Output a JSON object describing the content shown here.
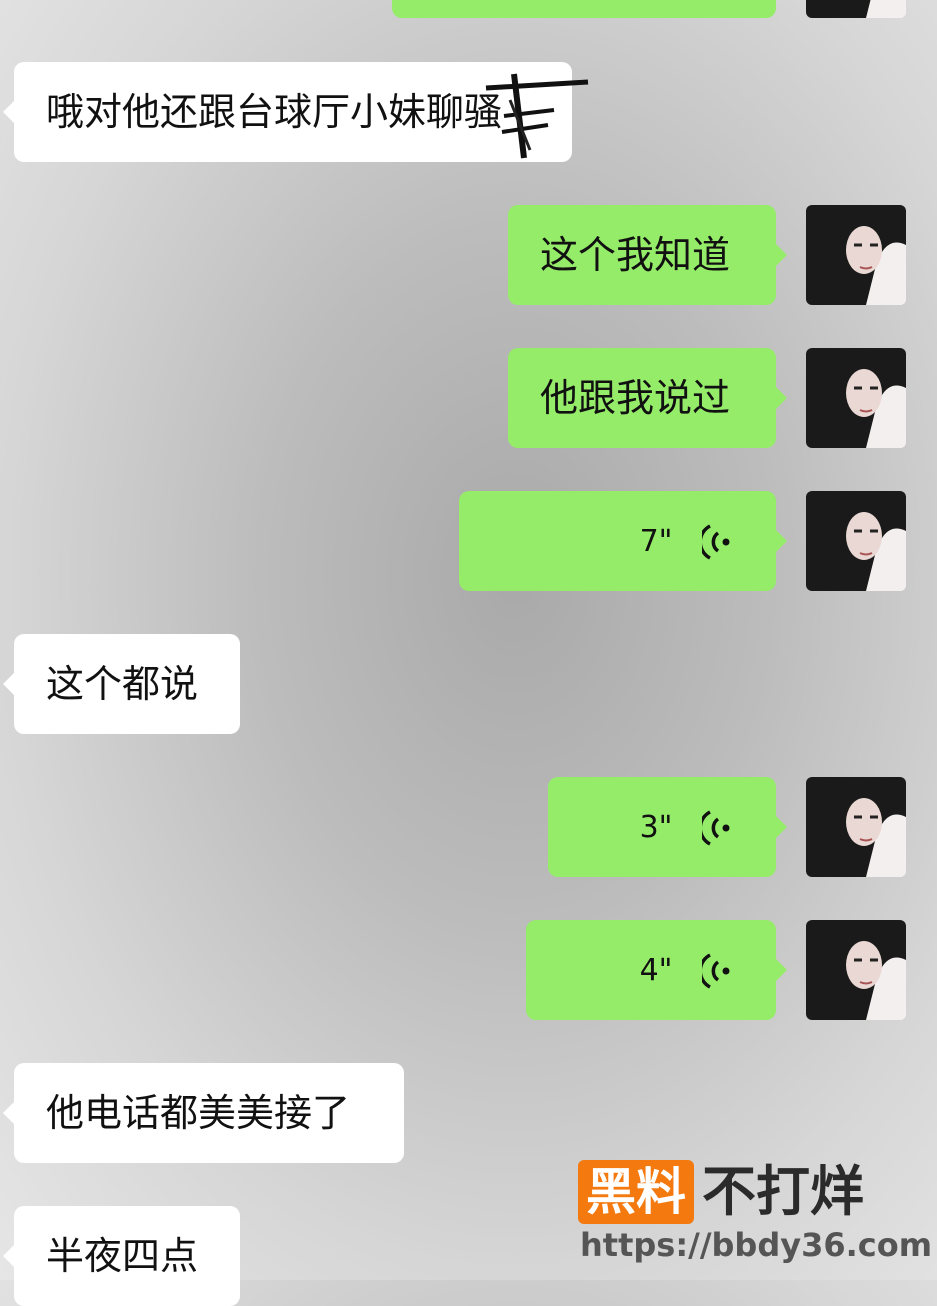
{
  "messages": [
    {
      "side": "left",
      "text": "哦对他还跟台球厅小妹聊骚"
    },
    {
      "side": "right",
      "text": "这个我知道"
    },
    {
      "side": "right",
      "text": "他跟我说过"
    },
    {
      "side": "right",
      "type": "voice",
      "duration": "7\""
    },
    {
      "side": "left",
      "text": "这个都说"
    },
    {
      "side": "right",
      "type": "voice",
      "duration": "3\""
    },
    {
      "side": "right",
      "type": "voice",
      "duration": "4\""
    },
    {
      "side": "left",
      "text": "他电话都美美接了"
    },
    {
      "side": "left",
      "text": "半夜四点"
    }
  ],
  "watermark": {
    "brand_box": "黑料",
    "brand_text": "不打烊",
    "url": "https://bbdy36.com"
  },
  "colors": {
    "outgoing_bubble": "#95ec69",
    "incoming_bubble": "#ffffff",
    "watermark_accent": "#f47a10"
  },
  "icons": {
    "voice": "voice-wave-icon",
    "avatar": "user-avatar-photo"
  }
}
